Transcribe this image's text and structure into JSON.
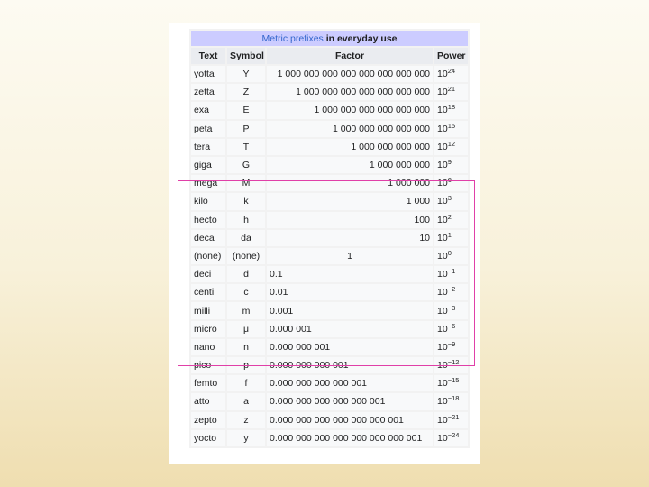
{
  "table": {
    "caption_link": "Metric prefixes",
    "caption_rest": "in everyday use",
    "headers": {
      "text": "Text",
      "symbol": "Symbol",
      "factor": "Factor",
      "power": "Power"
    },
    "rows": [
      {
        "text": "yotta",
        "symbol": "Y",
        "factor": "1 000 000 000 000 000 000 000 000",
        "base": "10",
        "exp": "24"
      },
      {
        "text": "zetta",
        "symbol": "Z",
        "factor": "1 000 000 000 000 000 000 000",
        "base": "10",
        "exp": "21"
      },
      {
        "text": "exa",
        "symbol": "E",
        "factor": "1 000 000 000 000 000 000",
        "base": "10",
        "exp": "18"
      },
      {
        "text": "peta",
        "symbol": "P",
        "factor": "1 000 000 000 000 000",
        "base": "10",
        "exp": "15"
      },
      {
        "text": "tera",
        "symbol": "T",
        "factor": "1 000 000 000 000",
        "base": "10",
        "exp": "12"
      },
      {
        "text": "giga",
        "symbol": "G",
        "factor": "1 000 000 000",
        "base": "10",
        "exp": "9"
      },
      {
        "text": "mega",
        "symbol": "M",
        "factor": "1 000 000",
        "base": "10",
        "exp": "6"
      },
      {
        "text": "kilo",
        "symbol": "k",
        "factor": "1 000",
        "base": "10",
        "exp": "3"
      },
      {
        "text": "hecto",
        "symbol": "h",
        "factor": "100",
        "base": "10",
        "exp": "2"
      },
      {
        "text": "deca",
        "symbol": "da",
        "factor": "10",
        "base": "10",
        "exp": "1"
      },
      {
        "text": "(none)",
        "symbol": "(none)",
        "factor": "1",
        "base": "10",
        "exp": "0"
      },
      {
        "text": "deci",
        "symbol": "d",
        "factor": "0.1",
        "base": "10",
        "exp": "−1"
      },
      {
        "text": "centi",
        "symbol": "c",
        "factor": "0.01",
        "base": "10",
        "exp": "−2"
      },
      {
        "text": "milli",
        "symbol": "m",
        "factor": "0.001",
        "base": "10",
        "exp": "−3"
      },
      {
        "text": "micro",
        "symbol": "μ",
        "factor": "0.000 001",
        "base": "10",
        "exp": "−6"
      },
      {
        "text": "nano",
        "symbol": "n",
        "factor": "0.000 000 001",
        "base": "10",
        "exp": "−9"
      },
      {
        "text": "pico",
        "symbol": "p",
        "factor": "0.000 000 000 001",
        "base": "10",
        "exp": "−12"
      },
      {
        "text": "femto",
        "symbol": "f",
        "factor": "0.000 000 000 000 001",
        "base": "10",
        "exp": "−15"
      },
      {
        "text": "atto",
        "symbol": "a",
        "factor": "0.000 000 000 000 000 001",
        "base": "10",
        "exp": "−18"
      },
      {
        "text": "zepto",
        "symbol": "z",
        "factor": "0.000 000 000 000 000 000 001",
        "base": "10",
        "exp": "−21"
      },
      {
        "text": "yocto",
        "symbol": "y",
        "factor": "0.000 000 000 000 000 000 000 001",
        "base": "10",
        "exp": "−24"
      }
    ]
  },
  "colors": {
    "caption_bg": "#ccccff",
    "header_bg": "#eaecf0",
    "cell_bg": "#f8f9fa",
    "link": "#3366cc",
    "highlight": "#e040a8"
  }
}
